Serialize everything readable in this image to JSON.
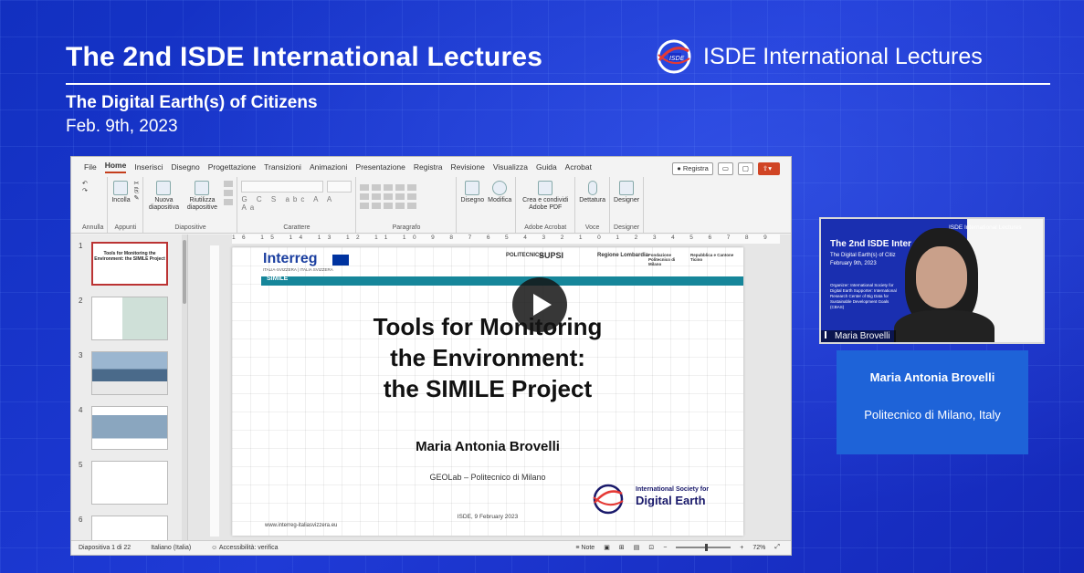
{
  "event": {
    "title": "The 2nd ISDE International Lectures",
    "brand": "ISDE International Lectures",
    "subtitle": "The Digital Earth(s) of Citizens",
    "date": "Feb. 9th, 2023"
  },
  "ppt": {
    "menu": [
      "File",
      "Home",
      "Inserisci",
      "Disegno",
      "Progettazione",
      "Transizioni",
      "Animazioni",
      "Presentazione",
      "Registra",
      "Revisione",
      "Visualizza",
      "Guida",
      "Acrobat"
    ],
    "active_menu": "Home",
    "registra_button": "Registra",
    "ribbon": {
      "annulla": "Annulla",
      "incolla": "Incolla",
      "appunti": "Appunti",
      "nuova_diapositiva": "Nuova diapositiva",
      "riutilizza": "Riutilizza diapositive",
      "diapositive": "Diapositive",
      "carattere": "Carattere",
      "paragrafo": "Paragrafo",
      "disegno": "Disegno",
      "modifica": "Modifica",
      "crea_pdf": "Crea e condividi Adobe PDF",
      "adobe_acrobat": "Adobe Acrobat",
      "dettatura": "Dettatura",
      "voce": "Voce",
      "designer": "Designer",
      "designer_group": "Designer"
    },
    "thumbnail_numbers": [
      "1",
      "2",
      "3",
      "4",
      "5",
      "6"
    ],
    "thumb1_text": "Tools for Monitoring the Environment: the SIMILE Project",
    "ruler": "16 15 14 13 12 11 10 9 8 7 6 5 4 3 2 1 0 1 2 3 4 5 6 7 8 9 10 11 12 13 14 15 16",
    "slide": {
      "interreg": "Interreg",
      "interreg_sub": "ITALIA-SVIZZERA | ITALIA SVIZZERA",
      "simile": "SIMILE",
      "partners": [
        "POLITECNICO",
        "SUPSI",
        "Regione Lombardia",
        "Fondazione Politecnico di Milano",
        "Repubblica e Cantone Ticino"
      ],
      "title_lines": [
        "Tools for Monitoring",
        "the Environment:",
        "the SIMILE Project"
      ],
      "author": "Maria Antonia Brovelli",
      "affiliation": "GEOLab – Politecnico di Milano",
      "date": "ISDE, 9 February 2023",
      "url": "www.interreg-italiasvizzera.eu",
      "isde_line1": "International Society for",
      "isde_line2": "Digital Earth"
    },
    "status": {
      "slide_count": "Diapositiva 1 di 22",
      "language": "Italiano (Italia)",
      "accessibility": "Accessibilità: verifica",
      "notes": "Note",
      "zoom": "72%"
    }
  },
  "webcam": {
    "overlay_title": "The 2nd ISDE Inter",
    "overlay_sub": "The Digital Earth(s) of Citiz",
    "overlay_date": "February 9th, 2023",
    "overlay_small": "Organizer: International Society for Digital Earth Supporter: International Research Center of Big Data for Sustainable Development Goals (CBAS)",
    "overlay_brand": "ISDE International Lectures",
    "name_tag": "Maria Brovelli"
  },
  "speaker": {
    "name": "Maria Antonia Brovelli",
    "affiliation": "Politecnico di Milano, Italy"
  },
  "colors": {
    "background": "#1a2fc8",
    "speaker_box": "#1e63d8",
    "accent_teal": "#16869a",
    "ppt_red": "#c43e1c"
  }
}
